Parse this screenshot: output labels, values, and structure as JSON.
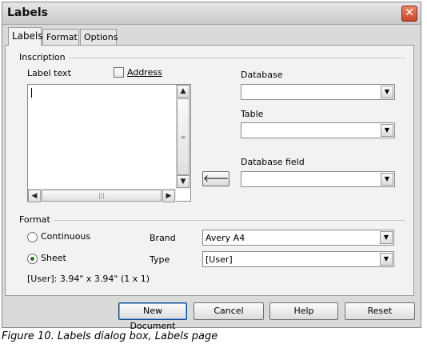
{
  "window": {
    "title": "Labels",
    "close_glyph": "✕"
  },
  "tabs": [
    {
      "label": "Labels",
      "active": true
    },
    {
      "label": "Format",
      "active": false
    },
    {
      "label": "Options",
      "active": false
    }
  ],
  "inscription": {
    "group_label": "Inscription",
    "label_text_label": "Label text",
    "address_label": "Address",
    "address_checked": false,
    "label_text_value": "",
    "database_label": "Database",
    "database_value": "",
    "table_label": "Table",
    "table_value": "",
    "database_field_label": "Database field",
    "database_field_value": "",
    "insert_arrow_glyph": "🡐"
  },
  "format": {
    "group_label": "Format",
    "continuous_label": "Continuous",
    "sheet_label": "Sheet",
    "selected": "Sheet",
    "brand_label": "Brand",
    "brand_value": "Avery A4",
    "type_label": "Type",
    "type_value": "[User]",
    "size_info": "[User]: 3.94\" x 3.94\" (1 x 1)"
  },
  "buttons": {
    "new_document": "New Document",
    "cancel": "Cancel",
    "help": "Help",
    "reset": "Reset"
  },
  "icons": {
    "scroll_up": "▲",
    "scroll_down": "▼",
    "scroll_left": "◀",
    "scroll_right": "▶",
    "dropdown": "▼",
    "grip_v": "≡",
    "grip_h": "|||"
  },
  "caption": "Figure 10. Labels dialog box, Labels page"
}
